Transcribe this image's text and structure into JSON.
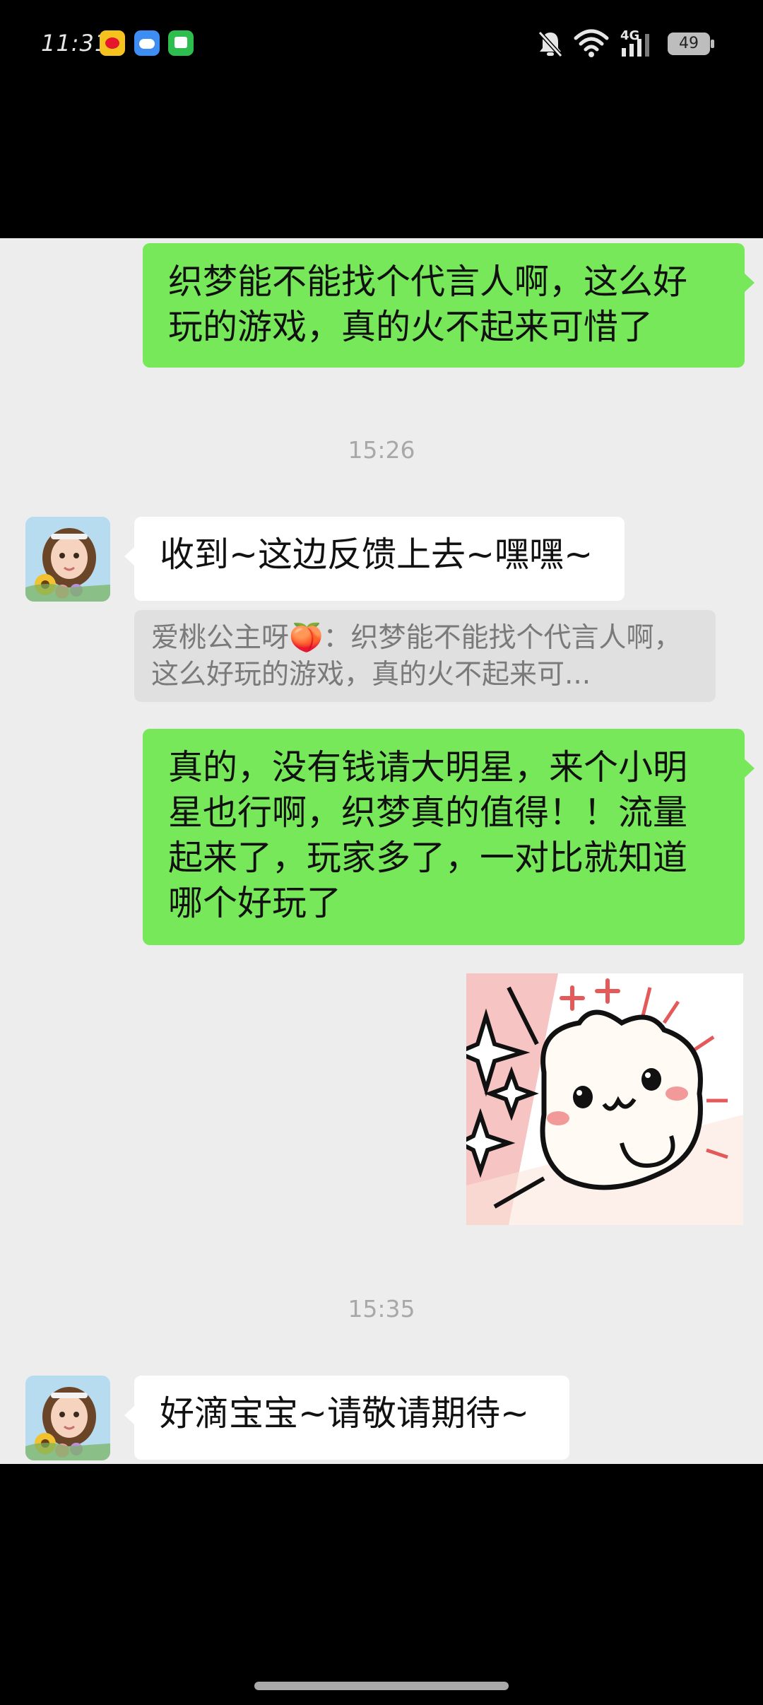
{
  "status_bar": {
    "time": "11:31",
    "battery_level": "49",
    "network_label": "4G",
    "app_icons": [
      "weibo-icon",
      "cloud-icon",
      "messages-icon"
    ],
    "system_icons": [
      "mute-icon",
      "wifi-icon",
      "signal-icon",
      "battery-icon"
    ]
  },
  "chat": {
    "messages": [
      {
        "sender": "me",
        "type": "text",
        "text": "织梦能不能找个代言人啊，这么好玩的游戏，真的火不起来可惜了"
      },
      {
        "type": "timestamp",
        "text": "15:26"
      },
      {
        "sender": "them",
        "type": "text",
        "text": "收到~这边反馈上去~嘿嘿~"
      },
      {
        "type": "quote",
        "text": "爱桃公主呀🍑：织梦能不能找个代言人啊，这么好玩的游戏，真的火不起来可..."
      },
      {
        "sender": "me",
        "type": "text",
        "text": "真的，没有钱请大明星，来个小明星也行啊，织梦真的值得！！流量起来了，玩家多了，一对比就知道哪个好玩了"
      },
      {
        "sender": "me",
        "type": "sticker",
        "sticker": "cute-cat-sticker-icon"
      },
      {
        "type": "timestamp",
        "text": "15:35"
      },
      {
        "sender": "them",
        "type": "text",
        "text": "好滴宝宝~请敬请期待~"
      }
    ]
  },
  "colors": {
    "my_bubble": "#77e85a",
    "their_bubble": "#ffffff",
    "chat_background": "#ededed",
    "timestamp_text": "#a8a8a8",
    "quote_background": "#e0e0e0"
  }
}
